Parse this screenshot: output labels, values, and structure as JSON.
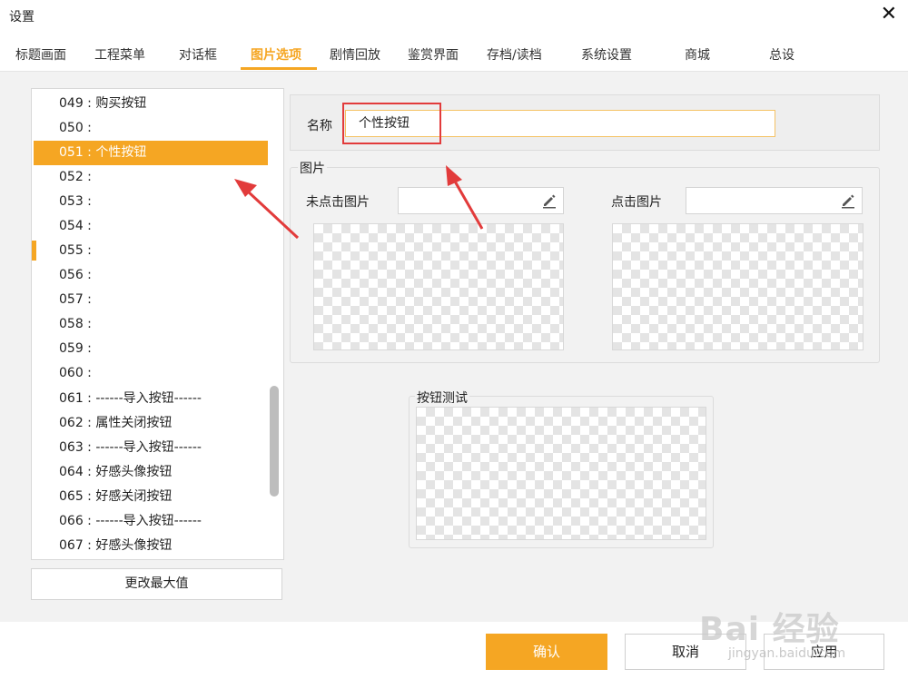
{
  "window": {
    "title": "设置"
  },
  "tabs": [
    {
      "label": "标题画面"
    },
    {
      "label": "工程菜单"
    },
    {
      "label": "对话框"
    },
    {
      "label": "图片选项"
    },
    {
      "label": "剧情回放"
    },
    {
      "label": "鉴赏界面"
    },
    {
      "label": "存档/读档"
    },
    {
      "label": "系统设置"
    },
    {
      "label": "商城"
    },
    {
      "label": "总设"
    }
  ],
  "active_tab": "图片选项",
  "list": {
    "items": [
      {
        "label": "049 : 购买按钮"
      },
      {
        "label": "050 :"
      },
      {
        "label": "051 : 个性按钮"
      },
      {
        "label": "052 :"
      },
      {
        "label": "053 :"
      },
      {
        "label": "054 :"
      },
      {
        "label": "055 :"
      },
      {
        "label": "056 :"
      },
      {
        "label": "057 :"
      },
      {
        "label": "058 :"
      },
      {
        "label": "059 :"
      },
      {
        "label": "060 :"
      },
      {
        "label": "061 : ------导入按钮------"
      },
      {
        "label": "062 : 属性关闭按钮"
      },
      {
        "label": "063 : ------导入按钮------"
      },
      {
        "label": "064 : 好感头像按钮"
      },
      {
        "label": "065 : 好感关闭按钮"
      },
      {
        "label": "066 : ------导入按钮------"
      },
      {
        "label": "067 : 好感头像按钮"
      }
    ],
    "selected": "051 : 个性按钮",
    "change_max_label": "更改最大值"
  },
  "form": {
    "name_label": "名称",
    "name_value": "个性按钮",
    "image_group_title": "图片",
    "unclicked_label": "未点击图片",
    "clicked_label": "点击图片",
    "test_group_title": "按钮测试"
  },
  "footer": {
    "ok_label": "确认",
    "cancel_label": "取消",
    "apply_label": "应用"
  },
  "watermark": {
    "text": "Bai 经验",
    "sub": "jingyan.baidu.com"
  },
  "colors": {
    "accent": "#f5a623",
    "annotation": "#e23b3b"
  }
}
